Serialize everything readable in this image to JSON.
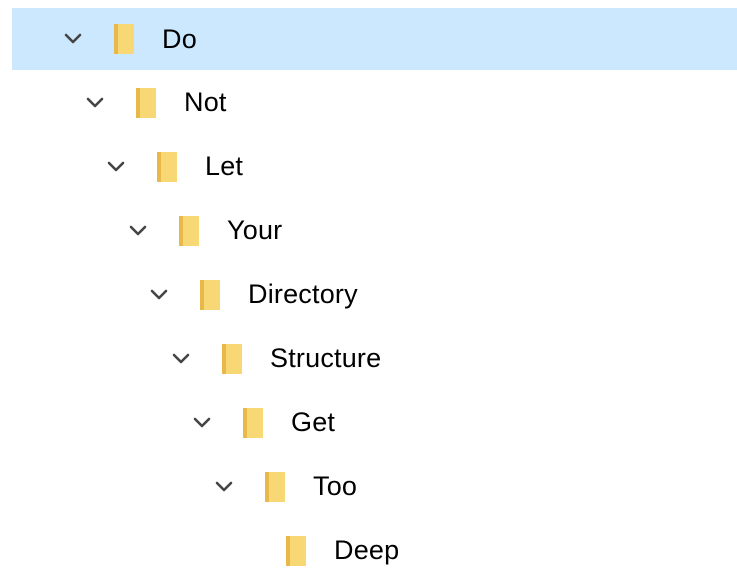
{
  "tree": {
    "colors": {
      "selection": "#cce8ff",
      "folder_light": "#f8d775",
      "folder_dark": "#e8b84a",
      "chevron": "#444444",
      "text": "#000000"
    },
    "items": [
      {
        "label": "Do",
        "depth": 0,
        "expanded": true,
        "selected": true,
        "icon": "folder-icon"
      },
      {
        "label": "Not",
        "depth": 1,
        "expanded": true,
        "selected": false,
        "icon": "folder-icon"
      },
      {
        "label": "Let",
        "depth": 2,
        "expanded": true,
        "selected": false,
        "icon": "folder-icon"
      },
      {
        "label": "Your",
        "depth": 3,
        "expanded": true,
        "selected": false,
        "icon": "folder-icon"
      },
      {
        "label": "Directory",
        "depth": 4,
        "expanded": true,
        "selected": false,
        "icon": "folder-icon"
      },
      {
        "label": "Structure",
        "depth": 5,
        "expanded": true,
        "selected": false,
        "icon": "folder-icon"
      },
      {
        "label": "Get",
        "depth": 6,
        "expanded": true,
        "selected": false,
        "icon": "folder-icon"
      },
      {
        "label": "Too",
        "depth": 7,
        "expanded": true,
        "selected": false,
        "icon": "folder-icon"
      },
      {
        "label": "Deep",
        "depth": 8,
        "expanded": false,
        "selected": false,
        "icon": "folder-icon"
      }
    ]
  }
}
